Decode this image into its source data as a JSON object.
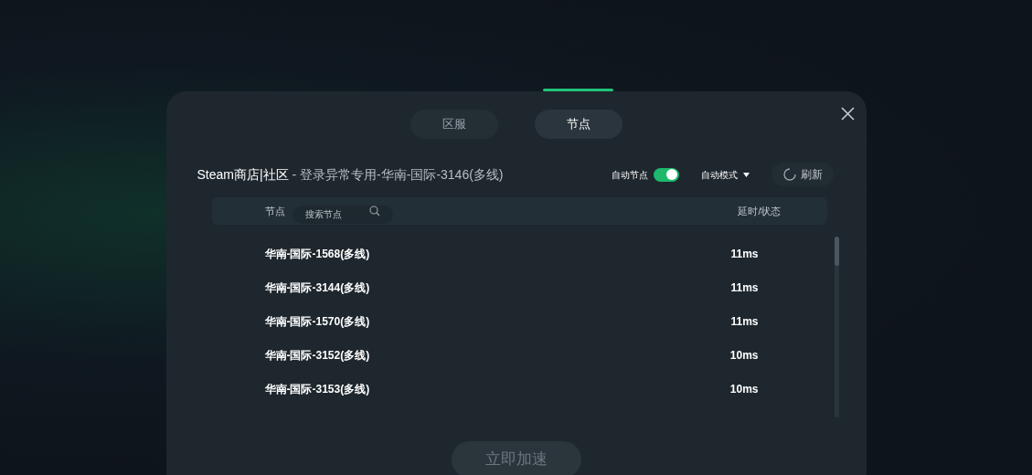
{
  "tabs": [
    {
      "label": "区服",
      "selected": false
    },
    {
      "label": "节点",
      "selected": true
    }
  ],
  "route": {
    "game": "Steam商店|社区",
    "separator": " - ",
    "node": "登录异常专用-华南-国际-3146(多线)"
  },
  "auto_node": {
    "label": "自动节点",
    "on": true
  },
  "mode": {
    "label": "自动模式"
  },
  "refresh": {
    "label": "刷新"
  },
  "table": {
    "columns": [
      "节点",
      "延时/状态"
    ],
    "search": {
      "placeholder": "搜索节点"
    },
    "rows": [
      {
        "name": "华南-国际-1568(多线)",
        "latency": "11ms"
      },
      {
        "name": "华南-国际-3144(多线)",
        "latency": "11ms"
      },
      {
        "name": "华南-国际-1570(多线)",
        "latency": "11ms"
      },
      {
        "name": "华南-国际-3152(多线)",
        "latency": "10ms"
      },
      {
        "name": "华南-国际-3153(多线)",
        "latency": "10ms"
      }
    ]
  },
  "action": {
    "label": "立即加速",
    "disabled": true
  }
}
